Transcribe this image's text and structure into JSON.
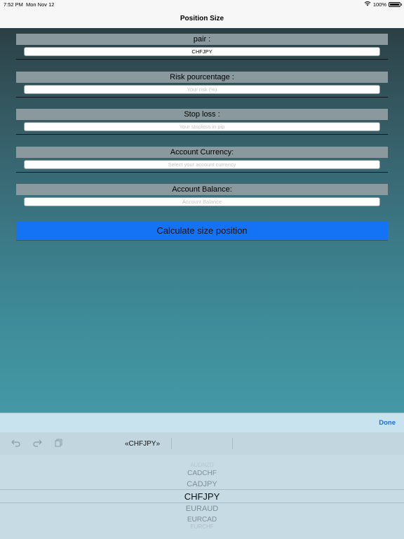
{
  "status_bar": {
    "time": "7:52 PM",
    "date": "Mon Nov 12",
    "battery": "100%",
    "battery_level": 1.0
  },
  "nav": {
    "title": "Position Size"
  },
  "fields": [
    {
      "label": "pair :",
      "value": "CHFJPY",
      "placeholder": ""
    },
    {
      "label": "Risk pourcentage :",
      "value": "",
      "placeholder": "Your risk (%)"
    },
    {
      "label": "Stop loss :",
      "value": "",
      "placeholder": "Your stoploss in pip"
    },
    {
      "label": "Account Currency:",
      "value": "",
      "placeholder": "Select your account currency"
    },
    {
      "label": "Account Balance:",
      "value": "",
      "placeholder": "Account Balance"
    }
  ],
  "calculate_button": "Calculate size position",
  "keyboard_toolbar": {
    "done": "Done"
  },
  "shortcut_bar": {
    "icons": [
      "undo-icon",
      "redo-icon",
      "paste-icon"
    ],
    "suggestion": "«CHFJPY»"
  },
  "picker": {
    "items": [
      "AUDNZD",
      "CADCHF",
      "CADJPY",
      "CHFJPY",
      "EURAUD",
      "EURCAD",
      "EURCHF"
    ],
    "selected_index": 3
  },
  "colors": {
    "accent_button": "#1472f5",
    "done_link": "#1a6fd8",
    "field_label_bg": "#8a999d"
  }
}
